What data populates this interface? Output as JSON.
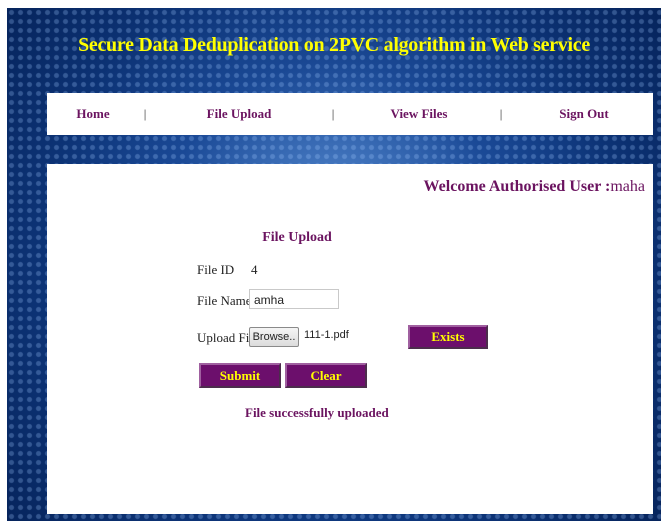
{
  "header": {
    "title": "Secure Data Deduplication on 2PVC algorithm in Web service"
  },
  "nav": {
    "items": [
      {
        "label": "Home"
      },
      {
        "label": "File Upload"
      },
      {
        "label": "View Files"
      },
      {
        "label": "Sign Out"
      }
    ],
    "separator": "|"
  },
  "welcome": {
    "prefix": "Welcome Authorised User :",
    "username": "maha"
  },
  "form": {
    "title": "File Upload",
    "file_id_label": "File ID",
    "file_id_value": "4",
    "file_name_label": "File Name",
    "file_name_value": "amha",
    "upload_file_label": "Upload File",
    "browse_label": "Browse..",
    "selected_file": "111-1.pdf",
    "exists_label": "Exists",
    "submit_label": "Submit",
    "clear_label": "Clear",
    "status_message": "File successfully uploaded"
  },
  "colors": {
    "accent_purple": "#6b1460",
    "title_yellow": "#ffff00",
    "button_bg": "#6c0f6c"
  }
}
